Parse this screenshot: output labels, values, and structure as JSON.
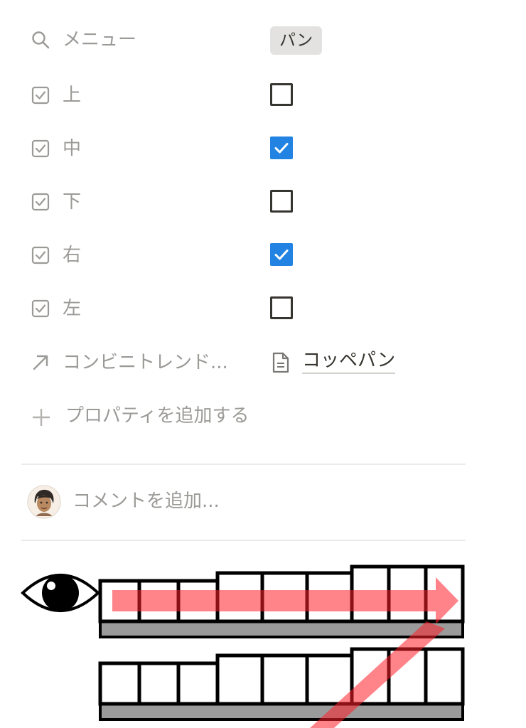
{
  "properties": {
    "menu": {
      "icon": "search-icon",
      "label": "メニュー",
      "tag": "パン",
      "tag_bg": "#e3e2e0"
    },
    "checkbox_rows": [
      {
        "icon": "checkbox-property-icon",
        "label": "上",
        "checked": false
      },
      {
        "icon": "checkbox-property-icon",
        "label": "中",
        "checked": true
      },
      {
        "icon": "checkbox-property-icon",
        "label": "下",
        "checked": false
      },
      {
        "icon": "checkbox-property-icon",
        "label": "右",
        "checked": true
      },
      {
        "icon": "checkbox-property-icon",
        "label": "左",
        "checked": false
      }
    ],
    "relation": {
      "icon": "arrow-up-right-icon",
      "label": "コンビニトレンド...",
      "page_icon": "document-icon",
      "value": "コッペパン"
    },
    "add_property": {
      "icon": "plus-icon",
      "label": "プロパティを追加する"
    }
  },
  "comment": {
    "avatar": "user-avatar",
    "placeholder": "コメントを追加..."
  },
  "colors": {
    "checked": "#2383e2",
    "muted_text": "#9b9a97",
    "text": "#37352f",
    "arrow": "#ff5a5f"
  },
  "illustration": {
    "icons": [
      "eye-icon"
    ],
    "description_marks": [
      "horizontal-arrow",
      "diagonal-arrow"
    ]
  }
}
